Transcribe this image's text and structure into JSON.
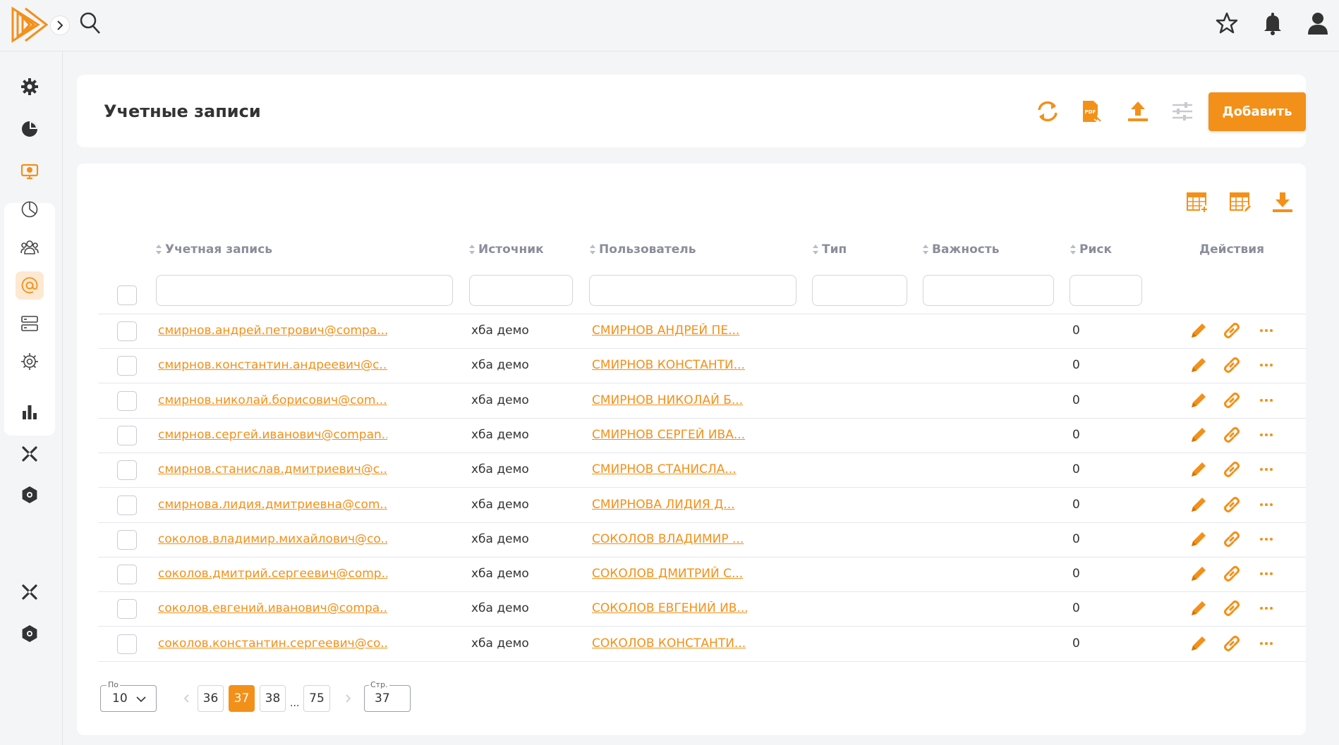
{
  "colors": {
    "accent": "#f39019",
    "background": "#f4f5f7",
    "card": "#ffffff"
  },
  "topbar": {
    "icons": [
      "logo-icon",
      "chevron-right-icon",
      "search-icon",
      "star-icon",
      "bell-icon",
      "user-icon"
    ]
  },
  "sidebar": {
    "icons": [
      "gear-icon",
      "pie-chart-icon",
      "monitor-alert-icon",
      "clock-pie-icon",
      "users-icon",
      "at-sign-icon",
      "server-icon",
      "settings-cog-icon",
      "bar-chart-icon",
      "cross-tools-icon",
      "hex-gear-icon",
      "cross-tools-icon",
      "hex-gear-icon"
    ]
  },
  "header": {
    "title": "Учетные записи",
    "add_label": "Добавить",
    "icons": [
      "refresh-icon",
      "pdf-export-icon",
      "upload-icon",
      "filter-sliders-icon"
    ]
  },
  "toolbar": {
    "icons": [
      "table-add-icon",
      "table-edit-icon",
      "download-icon"
    ]
  },
  "table": {
    "columns": {
      "account": "Учетная запись",
      "source": "Источник",
      "user": "Пользователь",
      "type": "Тип",
      "importance": "Важность",
      "risk": "Риск",
      "actions": "Действия"
    },
    "rows": [
      {
        "account": "смирнов.андрей.петрович@compa...",
        "source": "хба демо",
        "user": "СМИРНОВ АНДРЕЙ ПЕ...",
        "type": "",
        "importance": "",
        "risk": "0"
      },
      {
        "account": "смирнов.константин.андреевич@c...",
        "source": "хба демо",
        "user": "СМИРНОВ КОНСТАНТИ...",
        "type": "",
        "importance": "",
        "risk": "0"
      },
      {
        "account": "смирнов.николай.борисович@com...",
        "source": "хба демо",
        "user": "СМИРНОВ НИКОЛАЙ Б...",
        "type": "",
        "importance": "",
        "risk": "0"
      },
      {
        "account": "смирнов.сергей.иванович@compan...",
        "source": "хба демо",
        "user": "СМИРНОВ СЕРГЕЙ ИВА...",
        "type": "",
        "importance": "",
        "risk": "0"
      },
      {
        "account": "смирнов.станислав.дмитриевич@c...",
        "source": "хба демо",
        "user": "СМИРНОВ СТАНИСЛА...",
        "type": "",
        "importance": "",
        "risk": "0"
      },
      {
        "account": "смирнова.лидия.дмитриевна@com...",
        "source": "хба демо",
        "user": "СМИРНОВА ЛИДИЯ Д...",
        "type": "",
        "importance": "",
        "risk": "0"
      },
      {
        "account": "соколов.владимир.михайлович@co...",
        "source": "хба демо",
        "user": "СОКОЛОВ ВЛАДИМИР ...",
        "type": "",
        "importance": "",
        "risk": "0"
      },
      {
        "account": "соколов.дмитрий.сергеевич@comp...",
        "source": "хба демо",
        "user": "СОКОЛОВ ДМИТРИЙ С...",
        "type": "",
        "importance": "",
        "risk": "0"
      },
      {
        "account": "соколов.евгений.иванович@compa...",
        "source": "хба демо",
        "user": "СОКОЛОВ ЕВГЕНИЙ ИВ...",
        "type": "",
        "importance": "",
        "risk": "0"
      },
      {
        "account": "соколов.константин.сергеевич@co...",
        "source": "хба демо",
        "user": "СОКОЛОВ КОНСТАНТИ...",
        "type": "",
        "importance": "",
        "risk": "0"
      }
    ]
  },
  "pagination": {
    "per_page_label": "По",
    "per_page_value": "10",
    "pages": [
      "36",
      "37",
      "38"
    ],
    "ellipsis": "...",
    "last_page": "75",
    "current_page": "37",
    "goto_label": "Стр.",
    "goto_value": "37"
  }
}
